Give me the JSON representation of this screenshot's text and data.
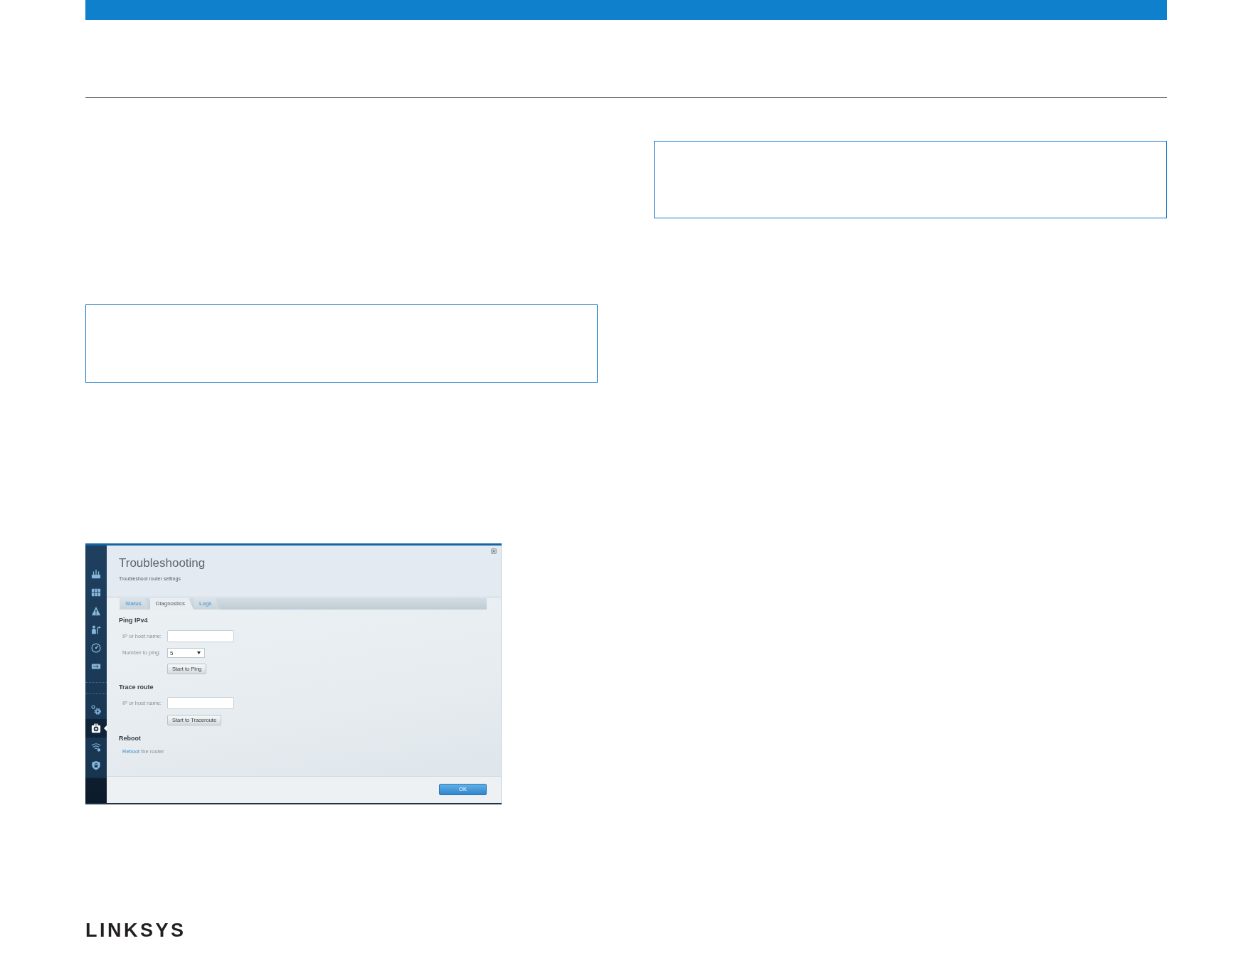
{
  "screenshot": {
    "title": "Troubleshooting",
    "subtitle": "Troubleshoot router settings",
    "sidebar": {
      "top_items": [
        {
          "selected": false
        },
        {
          "selected": false
        },
        {
          "selected": false
        },
        {
          "selected": false
        },
        {
          "selected": false
        },
        {
          "selected": false
        }
      ],
      "bottom_items": [
        {
          "selected": false
        },
        {
          "selected": true
        },
        {
          "selected": false
        },
        {
          "selected": false
        }
      ]
    },
    "tabs": [
      {
        "label": "Status",
        "selected": false
      },
      {
        "label": "Diagnostics",
        "selected": true
      },
      {
        "label": "Logs",
        "selected": false
      }
    ],
    "sections": [
      {
        "kind": "form",
        "heading": "Ping IPv4",
        "fields": [
          {
            "kind": "text",
            "label": "IP or host name:"
          },
          {
            "kind": "select",
            "label": "Number to ping:",
            "value": "5"
          }
        ],
        "button": "Start to Ping"
      },
      {
        "kind": "form",
        "heading": "Trace route",
        "fields": [
          {
            "kind": "text",
            "label": "IP or host name:"
          }
        ],
        "button": "Start to Traceroute"
      },
      {
        "kind": "link",
        "heading": "Reboot",
        "link": "Reboot",
        "text": "the router"
      }
    ],
    "ok_button": "OK"
  },
  "footer": {
    "logo": "LINKSYS"
  }
}
